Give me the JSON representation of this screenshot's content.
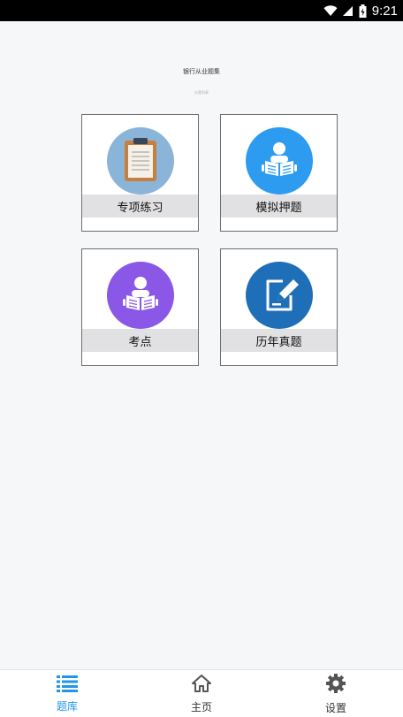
{
  "status_bar": {
    "time": "9:21"
  },
  "header": {
    "title": "银行从业题集",
    "subtitle": "分类列表"
  },
  "tiles": [
    {
      "label": "专项练习",
      "icon": "clipboard-icon",
      "color": "#8ab4d8"
    },
    {
      "label": "模拟押题",
      "icon": "reading-person-icon",
      "color": "#2d9bf0"
    },
    {
      "label": "考点",
      "icon": "reading-person-icon",
      "color": "#8a57e6"
    },
    {
      "label": "历年真题",
      "icon": "edit-pencil-icon",
      "color": "#1f6fb8"
    }
  ],
  "tab_bar": {
    "tabs": [
      {
        "label": "题库",
        "icon": "list-icon",
        "active": true
      },
      {
        "label": "主页",
        "icon": "home-icon",
        "active": false
      },
      {
        "label": "设置",
        "icon": "gear-icon",
        "active": false
      }
    ],
    "active_color": "#2196e8"
  }
}
